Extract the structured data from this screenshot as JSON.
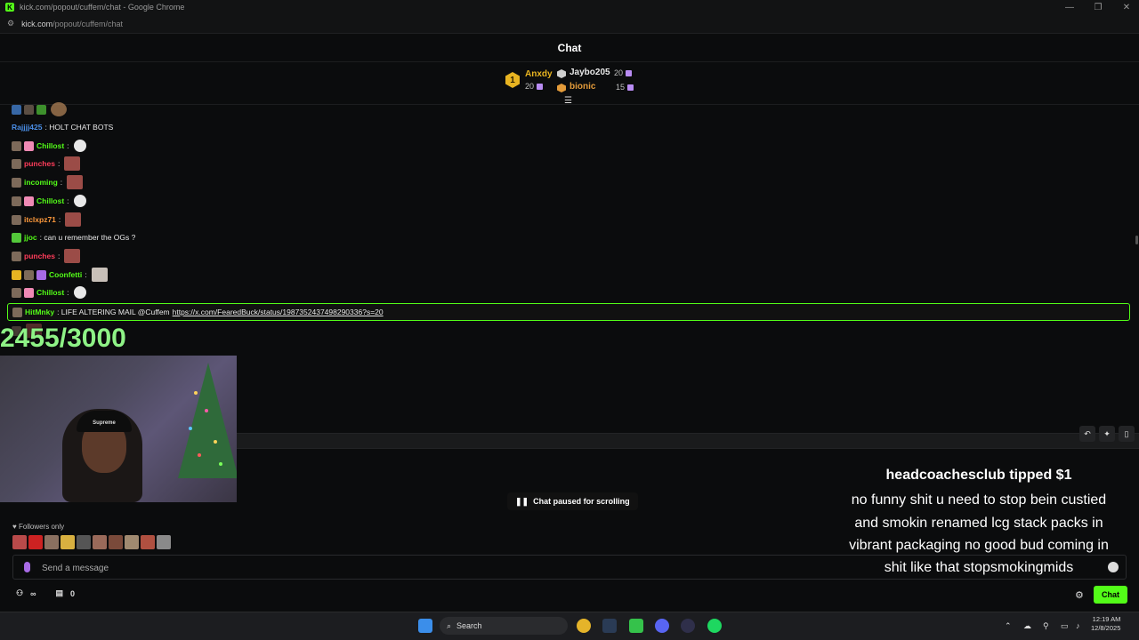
{
  "browser": {
    "window_title": "kick.com/popout/cuffem/chat - Google Chrome",
    "url_domain": "kick.com",
    "url_path": "/popout/cuffem/chat"
  },
  "header": {
    "title": "Chat"
  },
  "leaderboard": {
    "first": {
      "rank": "1",
      "name": "Anxdy",
      "count": "20"
    },
    "second": {
      "name": "Jaybo205",
      "count": "20"
    },
    "third": {
      "name": "bionic",
      "count": "15"
    }
  },
  "messages": [
    {
      "user": "Rajjjj425",
      "text": ": HOLT CHAT BOTS",
      "color": "#4a8ee6"
    },
    {
      "user": "Chillost",
      "text": ":",
      "color": "#53fc18"
    },
    {
      "user": "punches",
      "text": ":",
      "color": "#ff3c5a"
    },
    {
      "user": "incoming",
      "text": ":",
      "color": "#53fc18"
    },
    {
      "user": "Chillost",
      "text": ":",
      "color": "#53fc18"
    },
    {
      "user": "itclxpz71",
      "text": ":",
      "color": "#ff9a3c"
    },
    {
      "user": "jjoc",
      "text": ": can u remember the OGs ?",
      "color": "#53fc18"
    },
    {
      "user": "punches",
      "text": ":",
      "color": "#ff3c5a"
    },
    {
      "user": "Coonfetti",
      "text": ":",
      "color": "#53fc18"
    },
    {
      "user": "Chillost",
      "text": ":",
      "color": "#53fc18"
    }
  ],
  "highlight": {
    "user": "HitMnky",
    "text": ": LIFE ALTERING MAIL @Cuffem ",
    "link": "https://x.com/FearedBuck/status/1987352437498290336?s=20"
  },
  "overlay": {
    "counter": "2455/3000"
  },
  "tip": {
    "title": "headcoachesclub tipped $1",
    "lines": [
      "no funny shit u need to stop bein custied",
      "and smokin renamed lcg stack packs in",
      "vibrant packaging no good bud coming in",
      "shit like that stopsmokingmids"
    ]
  },
  "paused": {
    "label": "Chat paused for scrolling"
  },
  "followers": {
    "label": "Followers only"
  },
  "input": {
    "placeholder": "Send a message"
  },
  "footer": {
    "count": "0",
    "chat_button": "Chat"
  },
  "taskbar": {
    "search": "Search",
    "time": "12:19 AM",
    "date": "12/8/2025"
  },
  "colors": {
    "accent": "#53fc18"
  }
}
